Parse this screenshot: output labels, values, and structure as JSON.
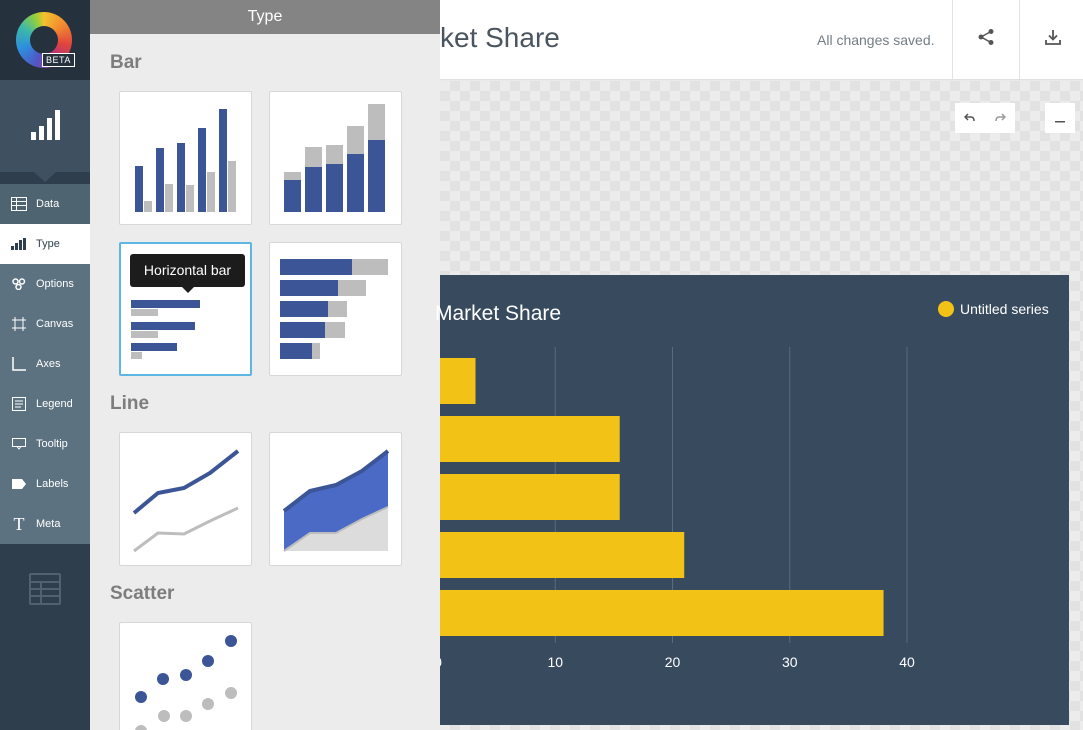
{
  "app": {
    "badge": "BETA"
  },
  "nav": {
    "items": [
      {
        "label": "Data",
        "icon": "table-icon"
      },
      {
        "label": "Type",
        "icon": "bar-chart-icon"
      },
      {
        "label": "Options",
        "icon": "options-icon"
      },
      {
        "label": "Canvas",
        "icon": "canvas-icon"
      },
      {
        "label": "Axes",
        "icon": "axes-icon"
      },
      {
        "label": "Legend",
        "icon": "legend-icon"
      },
      {
        "label": "Tooltip",
        "icon": "tooltip-icon"
      },
      {
        "label": "Labels",
        "icon": "label-icon"
      },
      {
        "label": "Meta",
        "icon": "text-icon"
      }
    ],
    "active": "Type"
  },
  "panel": {
    "title": "Type",
    "sections": {
      "bar": "Bar",
      "line": "Line",
      "scatter": "Scatter"
    },
    "tooltip": "Horizontal bar"
  },
  "topbar": {
    "title": "ket Share",
    "status": "All changes saved."
  },
  "colors": {
    "accent": "#f2c316",
    "chart_bg": "#374a5e",
    "blue": "#3b5597",
    "gray": "#bdbdbd",
    "selected": "#5eb6e3"
  },
  "chart_data": {
    "type": "bar",
    "orientation": "horizontal",
    "title": "Market Share",
    "series": [
      {
        "name": "Untitled series",
        "values": [
          3.2,
          15.5,
          15.5,
          21,
          38
        ]
      }
    ],
    "xticks": [
      "0",
      "10",
      "20",
      "30",
      "40"
    ],
    "xlim": [
      0,
      40
    ],
    "grid": true,
    "legend_position": "top-right"
  }
}
